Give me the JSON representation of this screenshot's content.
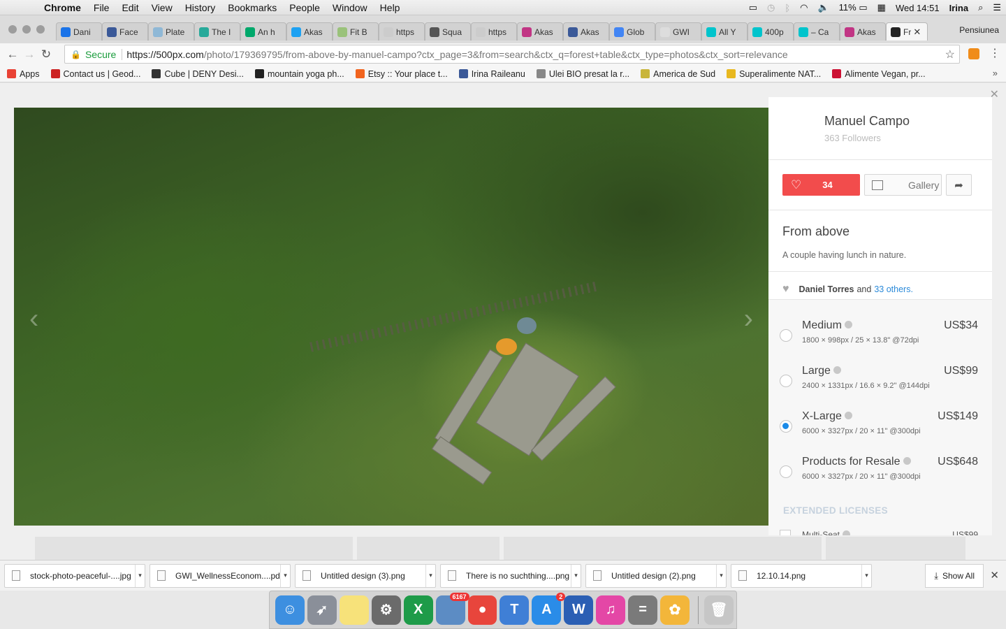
{
  "menubar": {
    "app": "Chrome",
    "items": [
      "File",
      "Edit",
      "View",
      "History",
      "Bookmarks",
      "People",
      "Window",
      "Help"
    ],
    "battery": "11%",
    "clock": "Wed 14:51",
    "user": "Irina"
  },
  "tabs": [
    {
      "label": "Dani",
      "color": "#1a73e8"
    },
    {
      "label": "Face",
      "color": "#3b5998"
    },
    {
      "label": "Plate",
      "color": "#8fb8d6"
    },
    {
      "label": "The I",
      "color": "#27a99a"
    },
    {
      "label": "An h",
      "color": "#00a86b"
    },
    {
      "label": "Akas",
      "color": "#1da1f2"
    },
    {
      "label": "Fit B",
      "color": "#9ac27a"
    },
    {
      "label": "https",
      "color": "#cccccc"
    },
    {
      "label": "Squa",
      "color": "#555555"
    },
    {
      "label": "https",
      "color": "#cccccc"
    },
    {
      "label": "Akas",
      "color": "#c13584"
    },
    {
      "label": "Akas",
      "color": "#3b5998"
    },
    {
      "label": "Glob",
      "color": "#4285f4"
    },
    {
      "label": "GWI",
      "color": "#dddddd"
    },
    {
      "label": "All Y",
      "color": "#00c4cc"
    },
    {
      "label": "400p",
      "color": "#00c4cc"
    },
    {
      "label": "– Ca",
      "color": "#00c4cc"
    },
    {
      "label": "Akas",
      "color": "#c13584"
    },
    {
      "label": "Fr",
      "color": "#222222",
      "active": true
    }
  ],
  "profile_name": "Pensiunea",
  "address": {
    "secure_label": "Secure",
    "host": "https://500px.com",
    "path": "/photo/179369795/from-above-by-manuel-campo?ctx_page=3&from=search&ctx_q=forest+table&ctx_type=photos&ctx_sort=relevance"
  },
  "bookmarks": [
    {
      "label": "Apps",
      "color": "#e94235"
    },
    {
      "label": "Contact us | Geod...",
      "color": "#cc2222"
    },
    {
      "label": "Cube | DENY Desi...",
      "color": "#333333"
    },
    {
      "label": "mountain yoga ph...",
      "color": "#222222"
    },
    {
      "label": "Etsy :: Your place t...",
      "color": "#f1641e"
    },
    {
      "label": "Irina Raileanu",
      "color": "#3b5998"
    },
    {
      "label": "Ulei BIO presat la r...",
      "color": "#888888"
    },
    {
      "label": "America de Sud",
      "color": "#c9b53a"
    },
    {
      "label": "Superalimente NAT...",
      "color": "#e8b820"
    },
    {
      "label": "Alimente Vegan, pr...",
      "color": "#cc1133"
    }
  ],
  "photo_panel": {
    "author_name": "Manuel Campo",
    "followers": "363 Followers",
    "like_count": "34",
    "gallery_label": "Gallery",
    "photo_title": "From above",
    "photo_desc": "A couple having lunch in nature.",
    "liked_by_name": "Daniel Torres",
    "liked_by_and": "and",
    "liked_by_others": "33 others.",
    "licenses": [
      {
        "name": "Medium",
        "dims": "1800 × 998px / 25 × 13.8\" @72dpi",
        "price": "US$34",
        "selected": false
      },
      {
        "name": "Large",
        "dims": "2400 × 1331px / 16.6 × 9.2\" @144dpi",
        "price": "US$99",
        "selected": false
      },
      {
        "name": "X-Large",
        "dims": "6000 × 3327px / 20 × 11\" @300dpi",
        "price": "US$149",
        "selected": true
      },
      {
        "name": "Products for Resale",
        "dims": "6000 × 3327px / 20 × 11\" @300dpi",
        "price": "US$648",
        "selected": false
      }
    ],
    "extended_title": "EXTENDED LICENSES",
    "extended_item": {
      "name": "Multi-Seat",
      "price": "US$99"
    }
  },
  "downloads": [
    "stock-photo-peaceful-....jpg",
    "GWI_WellnessEconom....pdf",
    "Untitled design (3).png",
    "There is no suchthing....png",
    "Untitled design (2).png",
    "12.10.14.png"
  ],
  "show_all_label": "Show All",
  "dock": [
    {
      "name": "finder-icon",
      "color": "#3d8fe0",
      "glyph": "☺"
    },
    {
      "name": "launchpad-icon",
      "color": "#8a8f99",
      "glyph": "➶"
    },
    {
      "name": "notes-icon",
      "color": "#f7e27a",
      "glyph": ""
    },
    {
      "name": "system-preferences-icon",
      "color": "#6b6b6b",
      "glyph": "⚙"
    },
    {
      "name": "excel-icon",
      "color": "#1e9b49",
      "glyph": "X"
    },
    {
      "name": "preview-icon",
      "color": "#5c8cc4",
      "glyph": "",
      "badge": "6167"
    },
    {
      "name": "chrome-icon",
      "color": "#e8453c",
      "glyph": "●"
    },
    {
      "name": "keynote-icon",
      "color": "#3f7fd6",
      "glyph": "T"
    },
    {
      "name": "app-store-icon",
      "color": "#2a8ce8",
      "glyph": "A",
      "badge": "2"
    },
    {
      "name": "word-icon",
      "color": "#2b5fb4",
      "glyph": "W"
    },
    {
      "name": "itunes-icon",
      "color": "#e447a6",
      "glyph": "♫"
    },
    {
      "name": "calculator-icon",
      "color": "#7a7a7a",
      "glyph": "="
    },
    {
      "name": "photos-icon",
      "color": "#f3b63a",
      "glyph": "✿"
    },
    {
      "name": "trash-icon",
      "color": "#c6c6c6",
      "glyph": "🗑"
    }
  ]
}
